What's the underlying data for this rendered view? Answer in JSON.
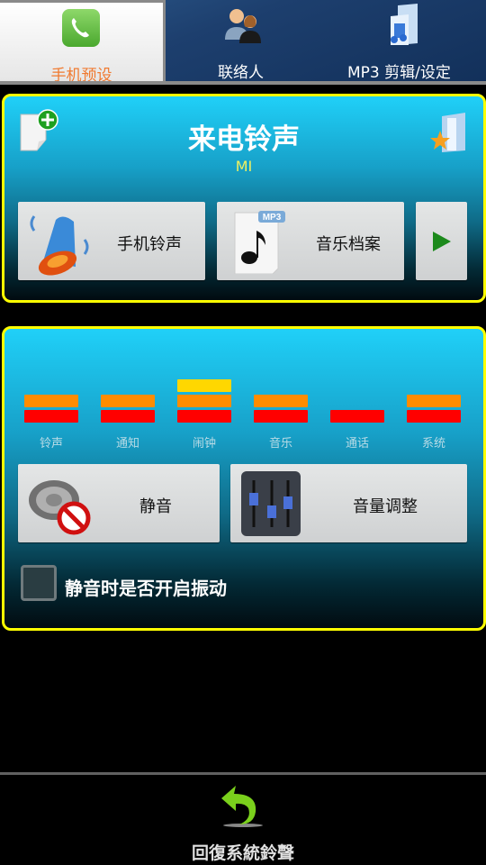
{
  "tabs": [
    {
      "label": "手机预设",
      "icon": "phone-icon",
      "active": true
    },
    {
      "label": "联络人",
      "icon": "contacts-icon",
      "active": false
    },
    {
      "label": "MP3 剪辑/设定",
      "icon": "music-folder-icon",
      "active": false
    }
  ],
  "ringtone_panel": {
    "title": "来电铃声",
    "subtitle": "MI",
    "add_icon": "add-file-icon",
    "favorite_icon": "favorite-folder-icon",
    "buttons": [
      {
        "label": "手机铃声",
        "icon": "bell-icon"
      },
      {
        "label": "音乐档案",
        "icon": "mp3-file-icon"
      },
      {
        "label": "",
        "icon": "play-arrow-icon"
      }
    ]
  },
  "volume_panel": {
    "levels": [
      {
        "label": "铃声",
        "level": 2,
        "max": 3
      },
      {
        "label": "通知",
        "level": 2,
        "max": 3
      },
      {
        "label": "闹钟",
        "level": 3,
        "max": 3
      },
      {
        "label": "音乐",
        "level": 2,
        "max": 3
      },
      {
        "label": "通话",
        "level": 1,
        "max": 3
      },
      {
        "label": "系统",
        "level": 2,
        "max": 3
      }
    ],
    "level_colors": [
      "#ff0000",
      "#ff8c00",
      "#ffd700"
    ],
    "mute_button": "静音",
    "volume_button": "音量调整",
    "vibrate_checkbox": {
      "label": "静音时是否开启振动",
      "checked": false
    }
  },
  "footer": {
    "restore_label": "回復系統鈴聲",
    "restore_icon": "undo-arrow-icon"
  }
}
